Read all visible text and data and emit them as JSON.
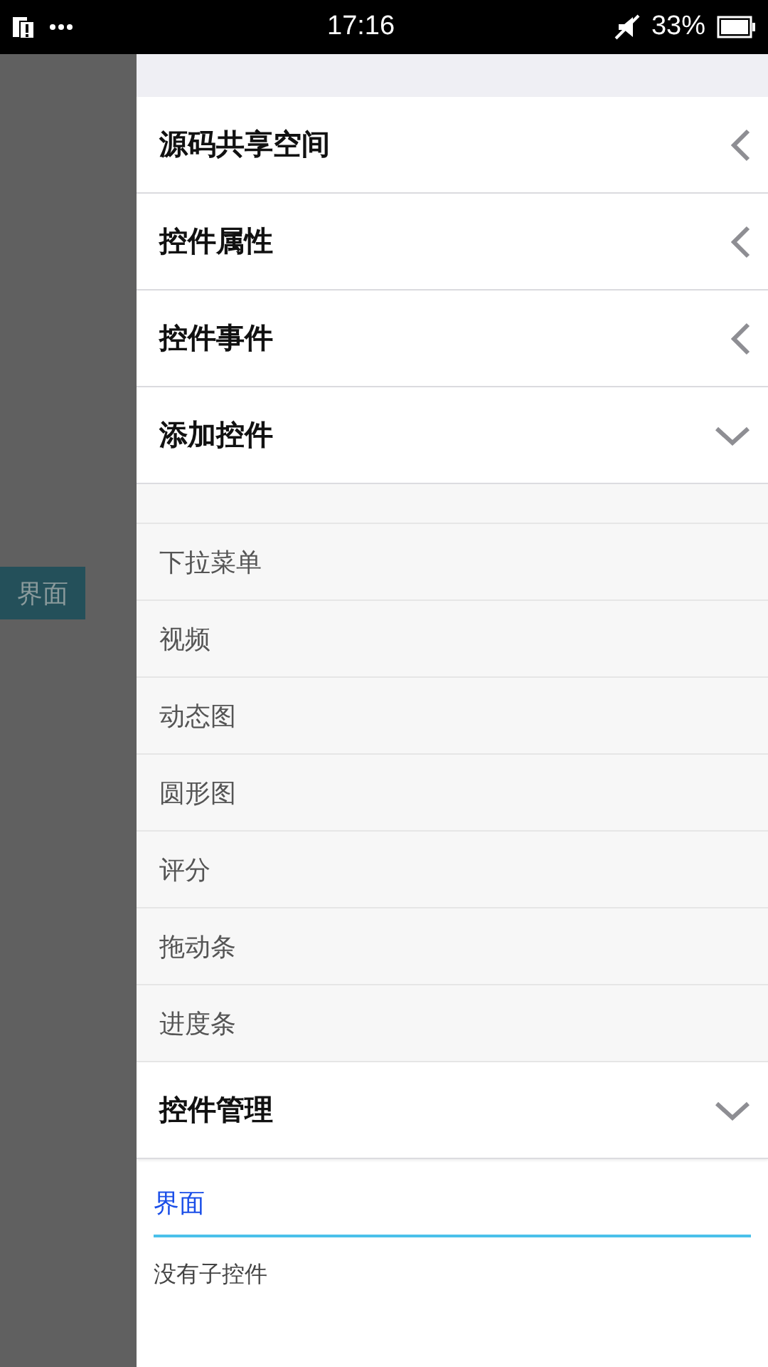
{
  "status_bar": {
    "time": "17:16",
    "battery_percent": "33%"
  },
  "side_tag": "界面",
  "sections": [
    {
      "title": "源码共享空间",
      "expanded": false
    },
    {
      "title": "控件属性",
      "expanded": false
    },
    {
      "title": "控件事件",
      "expanded": false
    },
    {
      "title": "添加控件",
      "expanded": true,
      "items": [
        "下拉菜单",
        "视频",
        "动态图",
        "圆形图",
        "评分",
        "拖动条",
        "进度条"
      ]
    },
    {
      "title": "控件管理",
      "expanded": true,
      "tab": "界面",
      "message": "没有子控件"
    }
  ]
}
